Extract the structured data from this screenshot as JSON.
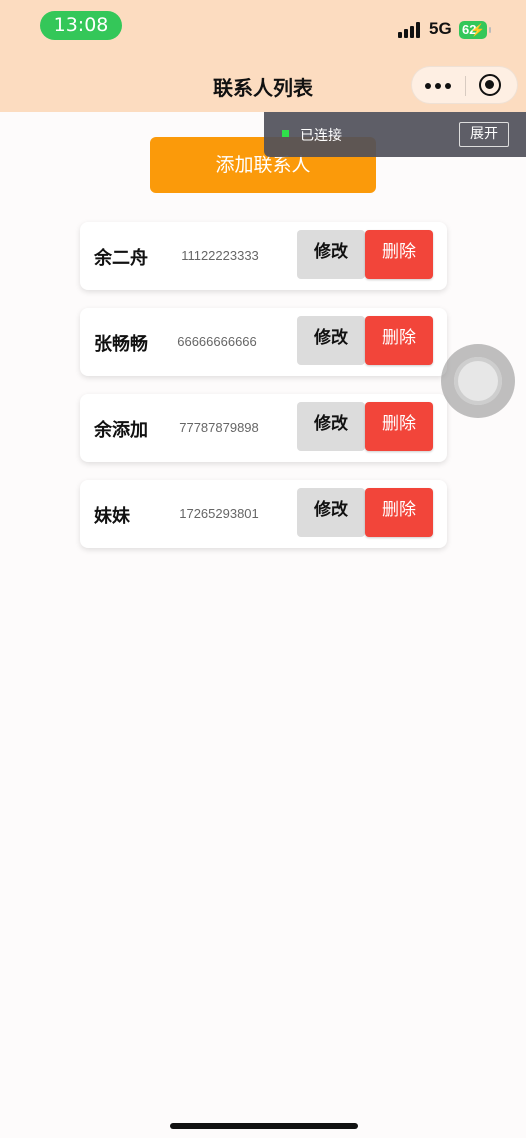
{
  "status_bar": {
    "time": "13:08",
    "network": "5G",
    "battery": "62"
  },
  "nav": {
    "title": "联系人列表"
  },
  "debug": {
    "status": "已连接",
    "expand_label": "展开"
  },
  "actions": {
    "add_label": "添加联系人"
  },
  "contacts": [
    {
      "name": "余二舟",
      "phone": "11122223333",
      "edit_label": "修改",
      "delete_label": "删除"
    },
    {
      "name": "张畅畅",
      "phone": "66666666666",
      "edit_label": "修改",
      "delete_label": "删除"
    },
    {
      "name": "余添加",
      "phone": "77787879898",
      "edit_label": "修改",
      "delete_label": "删除"
    },
    {
      "name": "妹妹",
      "phone": "17265293801",
      "edit_label": "修改",
      "delete_label": "删除"
    }
  ],
  "colors": {
    "header_bg": "#fcdcc0",
    "accent_orange": "#fb9a0a",
    "delete_red": "#f2453a",
    "status_green": "#34c759"
  }
}
